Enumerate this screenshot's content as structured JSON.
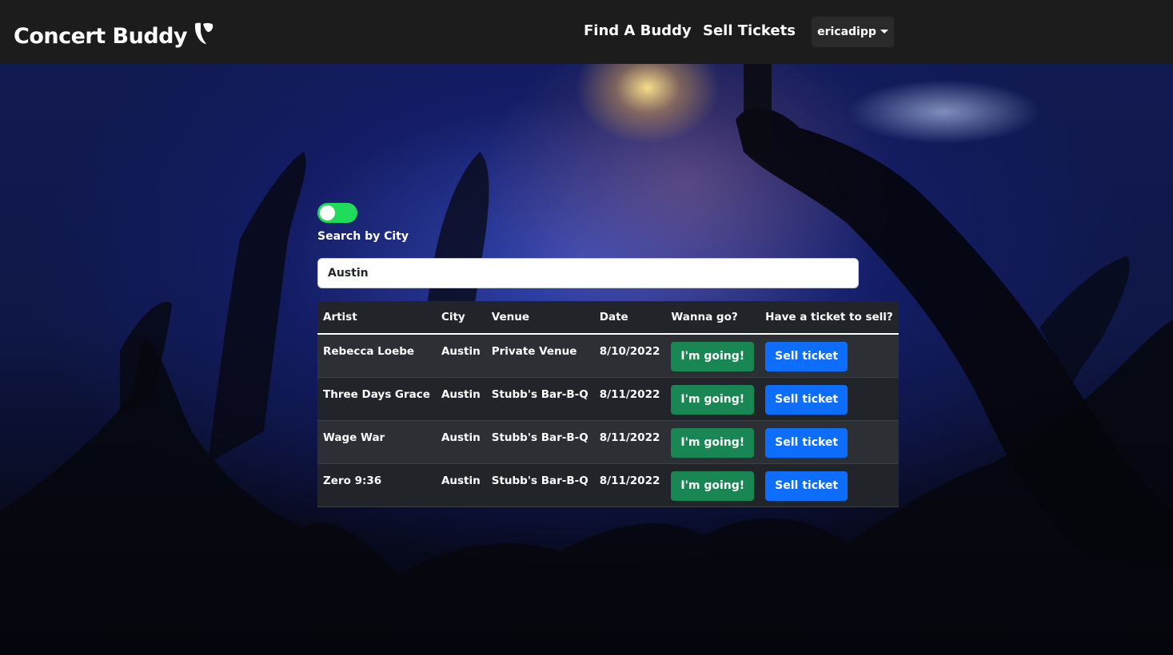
{
  "navbar": {
    "brand": "Concert Buddy",
    "links": [
      "Find A Buddy",
      "Sell Tickets"
    ],
    "user": "ericadipp"
  },
  "search": {
    "toggle_on": true,
    "toggle_label": "Search by City",
    "value": "Austin"
  },
  "table": {
    "headers": [
      "Artist",
      "City",
      "Venue",
      "Date",
      "Wanna go?",
      "Have a ticket to sell?"
    ],
    "rows": [
      {
        "artist": "Rebecca Loebe",
        "city": "Austin",
        "venue": "Private Venue",
        "date": "8/10/2022",
        "going_label": "I'm going!",
        "sell_label": "Sell ticket"
      },
      {
        "artist": "Three Days Grace",
        "city": "Austin",
        "venue": "Stubb's Bar-B-Q",
        "date": "8/11/2022",
        "going_label": "I'm going!",
        "sell_label": "Sell ticket"
      },
      {
        "artist": "Wage War",
        "city": "Austin",
        "venue": "Stubb's Bar-B-Q",
        "date": "8/11/2022",
        "going_label": "I'm going!",
        "sell_label": "Sell ticket"
      },
      {
        "artist": "Zero 9:36",
        "city": "Austin",
        "venue": "Stubb's Bar-B-Q",
        "date": "8/11/2022",
        "going_label": "I'm going!",
        "sell_label": "Sell ticket"
      }
    ]
  },
  "colors": {
    "navbar": "#1c1c1c",
    "toggle_on": "#1fdc5a",
    "going_button": "#198754",
    "sell_button": "#0d6efd",
    "table_bg": "#212529"
  },
  "icons": {
    "brand_logo": "typo3-logo-icon",
    "user_menu": "caret-down-icon"
  }
}
